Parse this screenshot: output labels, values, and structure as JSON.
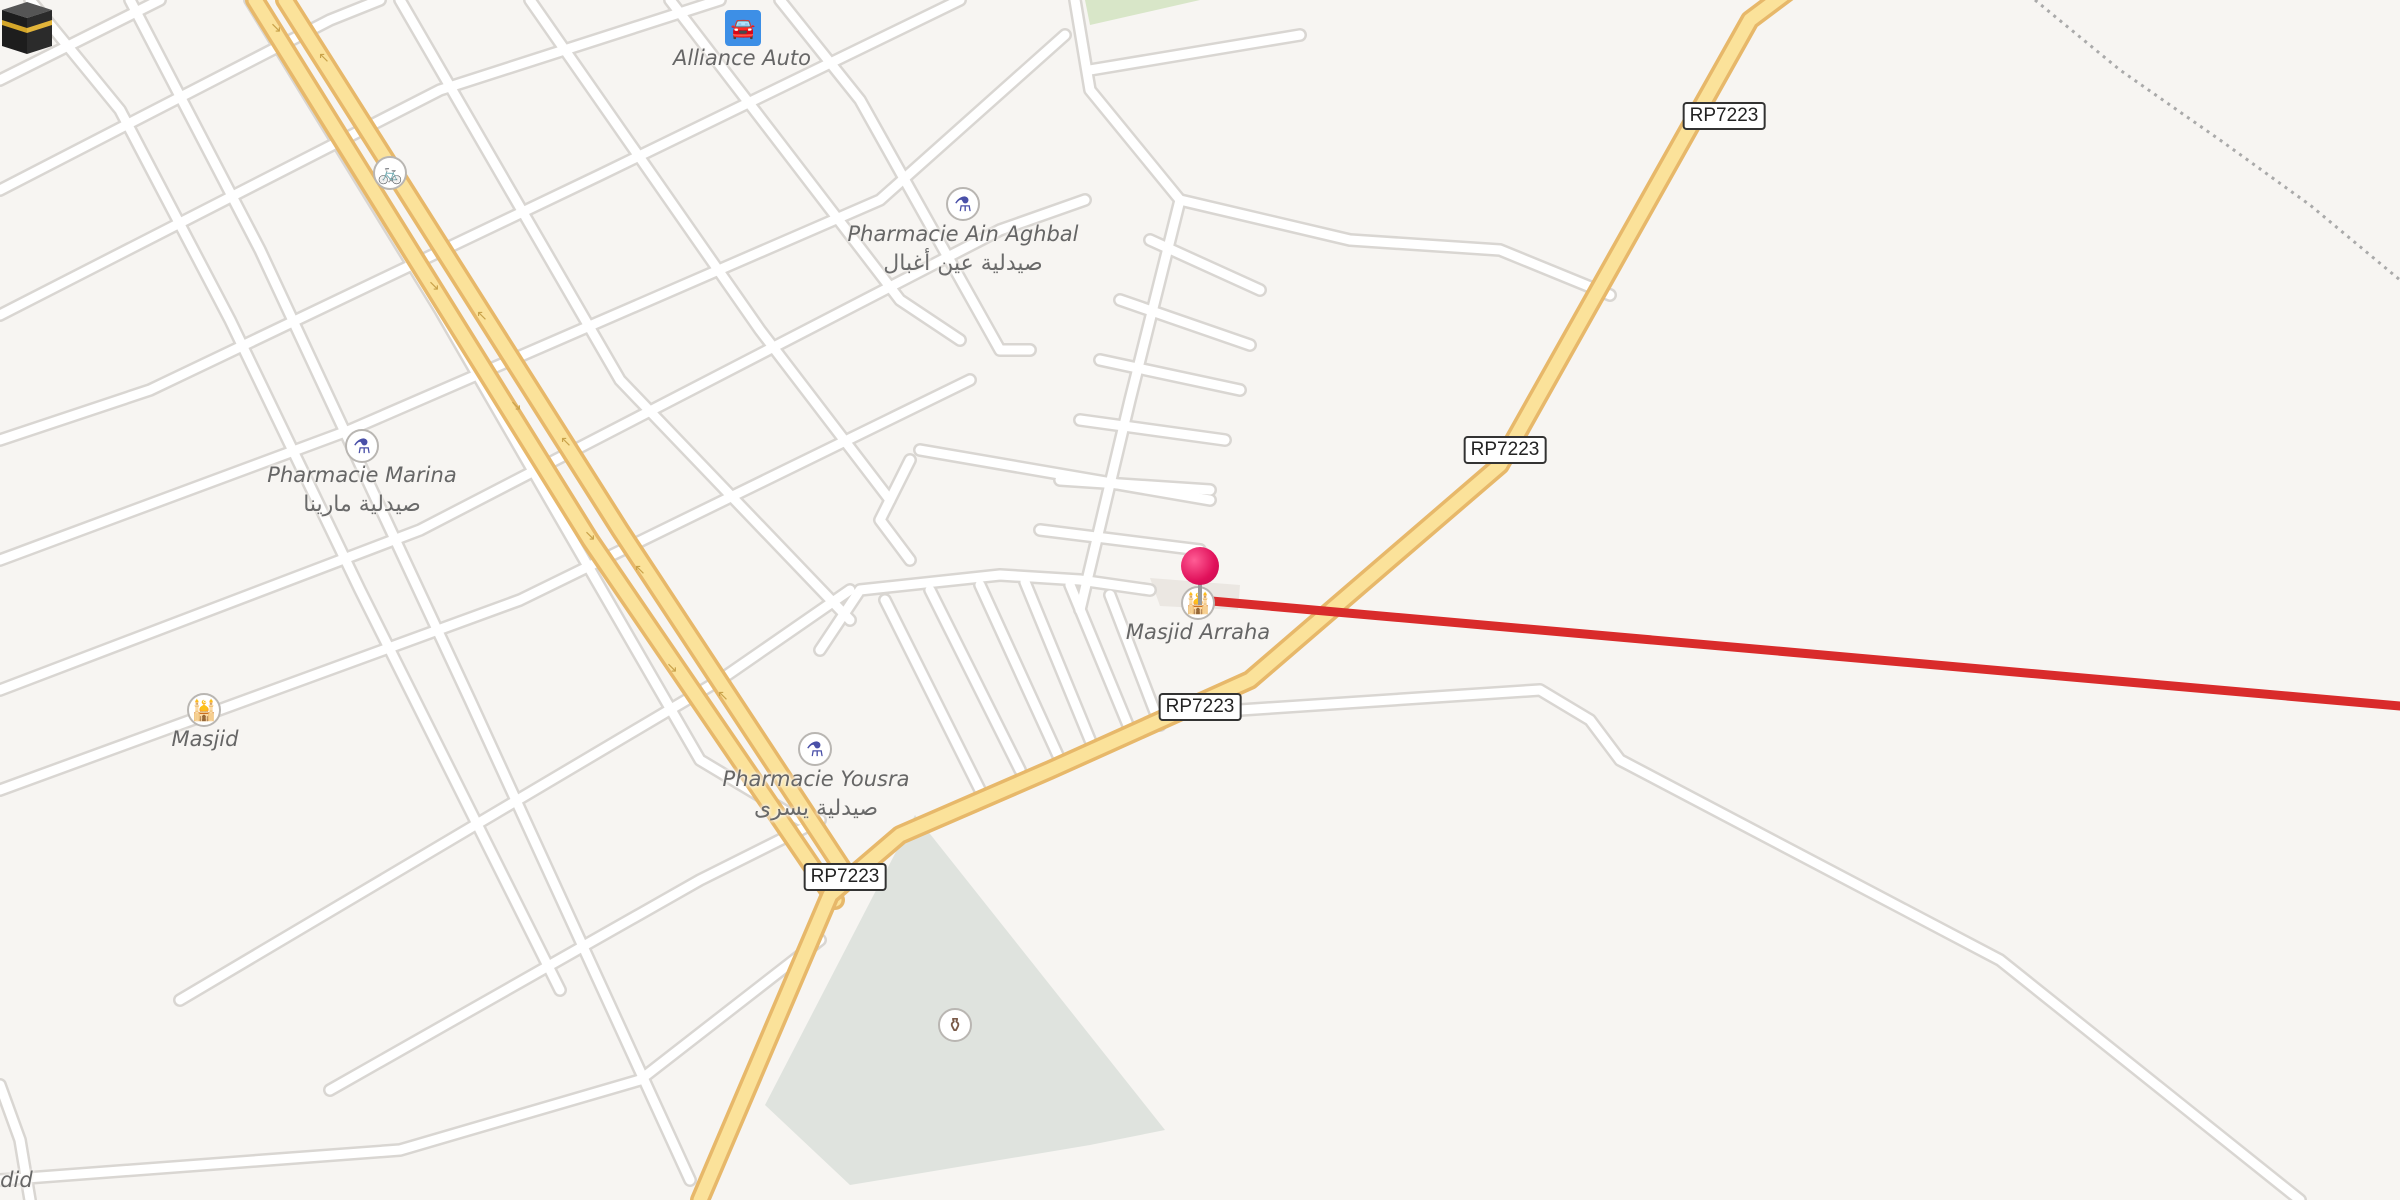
{
  "map": {
    "labels": {
      "alliance_auto": "Alliance Auto",
      "pharmacie_ain_aghbal": "Pharmacie Ain Aghbal",
      "pharmacie_ain_aghbal_ar": "صيدلية عين أغبال",
      "pharmacie_marina": "Pharmacie Marina",
      "pharmacie_marina_ar": "صيدلية مارينا",
      "masjid": "Masjid",
      "masjid_arraha": "Masjid Arraha",
      "pharmacie_yousra": "Pharmacie Yousra",
      "pharmacie_yousra_ar": "صيدلية يسرى",
      "edge_label": "adid"
    },
    "road_refs": {
      "ref1": "RP7223",
      "ref2": "RP7223",
      "ref3": "RP7223",
      "ref4": "RP7223"
    },
    "icons": {
      "car": "car-icon",
      "bicycle": "bicycle-icon",
      "pharmacy": "pharmacy-icon",
      "place_of_worship": "place-of-worship-icon",
      "cemetery": "cemetery-icon",
      "marker": "map-pin-icon",
      "kaaba": "kaaba-icon"
    },
    "colors": {
      "background": "#f7f5f2",
      "minor_road": "#ffffff",
      "road_casing": "#d9d6d2",
      "primary_road": "#fbe29a",
      "primary_casing": "#e7b86a",
      "route_line": "#d92b2b",
      "cemetery_area": "#dfe3de",
      "pin": "#e0105a"
    }
  }
}
